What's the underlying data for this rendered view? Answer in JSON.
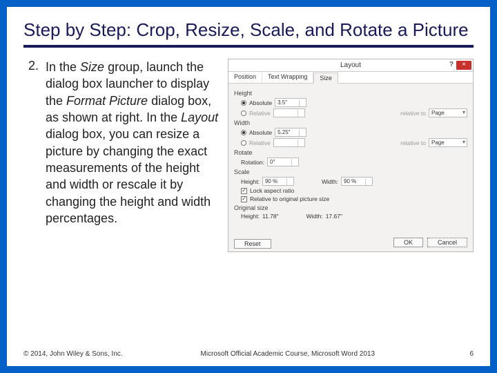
{
  "title": "Step by Step: Crop, Resize, Scale, and Rotate a Picture",
  "step": {
    "num": "2.",
    "text_parts": {
      "p1": "In the ",
      "i1": "Size",
      "p2": " group, launch the dialog box launcher to display the ",
      "i2": "Format Picture",
      "p3": " dialog box, as shown at right. In the ",
      "i3": "Layout",
      "p4": " dialog box, you can resize a picture by changing the exact measurements of the height and width or rescale it by changing the height and width percentages."
    }
  },
  "dialog": {
    "title": "Layout",
    "help": "?",
    "close": "×",
    "tabs": {
      "t1": "Position",
      "t2": "Text Wrapping",
      "t3": "Size"
    },
    "height": {
      "label": "Height",
      "absolute": "Absolute",
      "abs_val": "3.5\"",
      "relative": "Relative",
      "rel_to_lbl": "relative to",
      "rel_to_val": "Page"
    },
    "width": {
      "label": "Width",
      "absolute": "Absolute",
      "abs_val": "5.25\"",
      "relative": "Relative",
      "rel_to_lbl": "relative to",
      "rel_to_val": "Page"
    },
    "rotate": {
      "label": "Rotate",
      "rotation_lbl": "Rotation:",
      "val": "0°"
    },
    "scale": {
      "label": "Scale",
      "height_lbl": "Height:",
      "height_val": "90 %",
      "width_lbl": "Width:",
      "width_val": "90 %",
      "lock": "Lock aspect ratio",
      "relorig": "Relative to original picture size"
    },
    "orig": {
      "label": "Original size",
      "height_lbl": "Height:",
      "height_val": "11.78\"",
      "width_lbl": "Width:",
      "width_val": "17.67\""
    },
    "reset": "Reset",
    "ok": "OK",
    "cancel": "Cancel"
  },
  "footer": {
    "copyright": "© 2014, John Wiley & Sons, Inc.",
    "course": "Microsoft Official Academic Course, Microsoft Word 2013",
    "page": "6"
  }
}
